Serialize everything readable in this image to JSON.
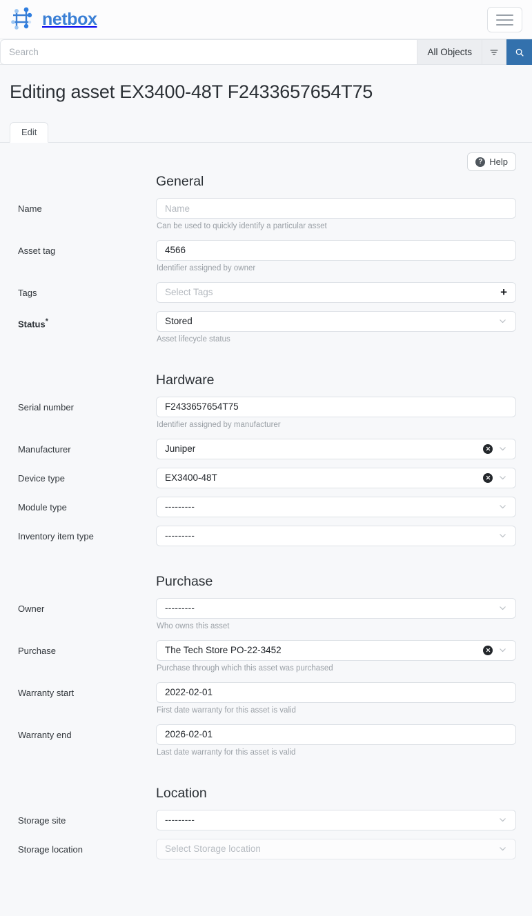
{
  "navbar": {
    "brand_name": "netbox",
    "logo_icon": "netbox-mesh-logo",
    "toggler_icon": "hamburger-menu-icon"
  },
  "search": {
    "placeholder": "Search",
    "value": "",
    "scope_label": "All Objects",
    "filter_icon": "filter-icon",
    "submit_icon": "search-icon"
  },
  "page": {
    "title": "Editing asset EX3400-48T F2433657654T75"
  },
  "tabs": [
    {
      "label": "Edit",
      "active": true
    }
  ],
  "help_button": {
    "label": "Help",
    "icon": "question-circle-icon"
  },
  "colors": {
    "brand_blue": "#3a7fd5",
    "search_button_blue": "#3371ad",
    "page_background": "#f7f8fa",
    "input_border": "#dde1e6",
    "muted_text": "#9aa0a6"
  },
  "sections": [
    {
      "title": "General",
      "fields": [
        {
          "label": "Name",
          "required": false,
          "control": "text",
          "value": "",
          "placeholder": "Name",
          "help": "Can be used to quickly identify a particular asset"
        },
        {
          "label": "Asset tag",
          "required": false,
          "control": "text",
          "value": "4566",
          "placeholder": "",
          "help": "Identifier assigned by owner"
        },
        {
          "label": "Tags",
          "required": false,
          "control": "tags",
          "value": "",
          "placeholder": "Select Tags",
          "add_icon": "plus-icon",
          "help": ""
        },
        {
          "label": "Status",
          "required": true,
          "control": "select",
          "value": "Stored",
          "clearable": false,
          "chevron_icon": "chevron-down-icon",
          "help": "Asset lifecycle status"
        }
      ]
    },
    {
      "title": "Hardware",
      "fields": [
        {
          "label": "Serial number",
          "required": false,
          "control": "text",
          "value": "F2433657654T75",
          "placeholder": "",
          "help": "Identifier assigned by manufacturer"
        },
        {
          "label": "Manufacturer",
          "required": false,
          "control": "select",
          "value": "Juniper",
          "clearable": true,
          "clear_icon": "clear-x-icon",
          "chevron_icon": "chevron-down-icon",
          "help": ""
        },
        {
          "label": "Device type",
          "required": false,
          "control": "select",
          "value": "EX3400-48T",
          "clearable": true,
          "clear_icon": "clear-x-icon",
          "chevron_icon": "chevron-down-icon",
          "help": ""
        },
        {
          "label": "Module type",
          "required": false,
          "control": "select",
          "value": "---------",
          "clearable": false,
          "chevron_icon": "chevron-down-icon",
          "help": ""
        },
        {
          "label": "Inventory item type",
          "required": false,
          "control": "select",
          "value": "---------",
          "clearable": false,
          "chevron_icon": "chevron-down-icon",
          "help": ""
        }
      ]
    },
    {
      "title": "Purchase",
      "fields": [
        {
          "label": "Owner",
          "required": false,
          "control": "select",
          "value": "---------",
          "clearable": false,
          "chevron_icon": "chevron-down-icon",
          "help": "Who owns this asset"
        },
        {
          "label": "Purchase",
          "required": false,
          "control": "select",
          "value": "The Tech Store PO-22-3452",
          "clearable": true,
          "clear_icon": "clear-x-icon",
          "chevron_icon": "chevron-down-icon",
          "help": "Purchase through which this asset was purchased"
        },
        {
          "label": "Warranty start",
          "required": false,
          "control": "text",
          "value": "2022-02-01",
          "placeholder": "",
          "help": "First date warranty for this asset is valid"
        },
        {
          "label": "Warranty end",
          "required": false,
          "control": "text",
          "value": "2026-02-01",
          "placeholder": "",
          "help": "Last date warranty for this asset is valid"
        }
      ]
    },
    {
      "title": "Location",
      "fields": [
        {
          "label": "Storage site",
          "required": false,
          "control": "select",
          "value": "---------",
          "clearable": false,
          "chevron_icon": "chevron-down-icon",
          "help": ""
        },
        {
          "label": "Storage location",
          "required": false,
          "control": "select",
          "value": "Select Storage location",
          "muted": true,
          "clearable": false,
          "chevron_icon": "chevron-down-icon",
          "help": ""
        }
      ]
    }
  ]
}
